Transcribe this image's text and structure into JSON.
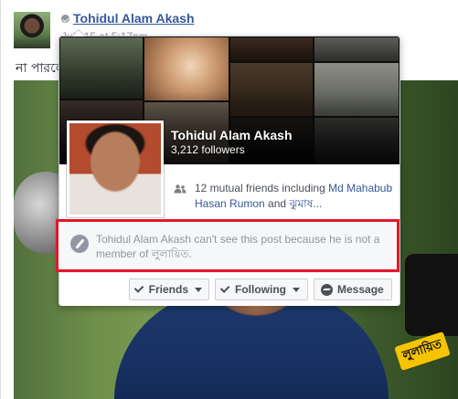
{
  "post": {
    "author_name": "Tohidul Alam Akash",
    "timestamp": "July 15 at 5:17pm",
    "text": "না পারলে",
    "photo_sign_text": "লুলায়িত"
  },
  "hovercard": {
    "name": "Tohidul Alam Akash",
    "followers": "3,212 followers",
    "mutual_prefix": "12 mutual friends including ",
    "mutual_friend_1": "Md Mahabub Hasan Rumon",
    "mutual_joiner": " and ",
    "mutual_friend_2": "ঝুমাষ...",
    "notice": "Tohidul Alam Akash can't see this post because he is not a member of লুলায়িত.",
    "buttons": {
      "friends": "Friends",
      "following": "Following",
      "message": "Message"
    }
  },
  "colors": {
    "link": "#365899",
    "highlight_border": "#e0182b",
    "muted_text": "#90949c"
  },
  "icons": [
    "globe-icon",
    "friends-icon",
    "blocked-icon",
    "check-icon",
    "caret-down-icon",
    "messenger-icon"
  ]
}
